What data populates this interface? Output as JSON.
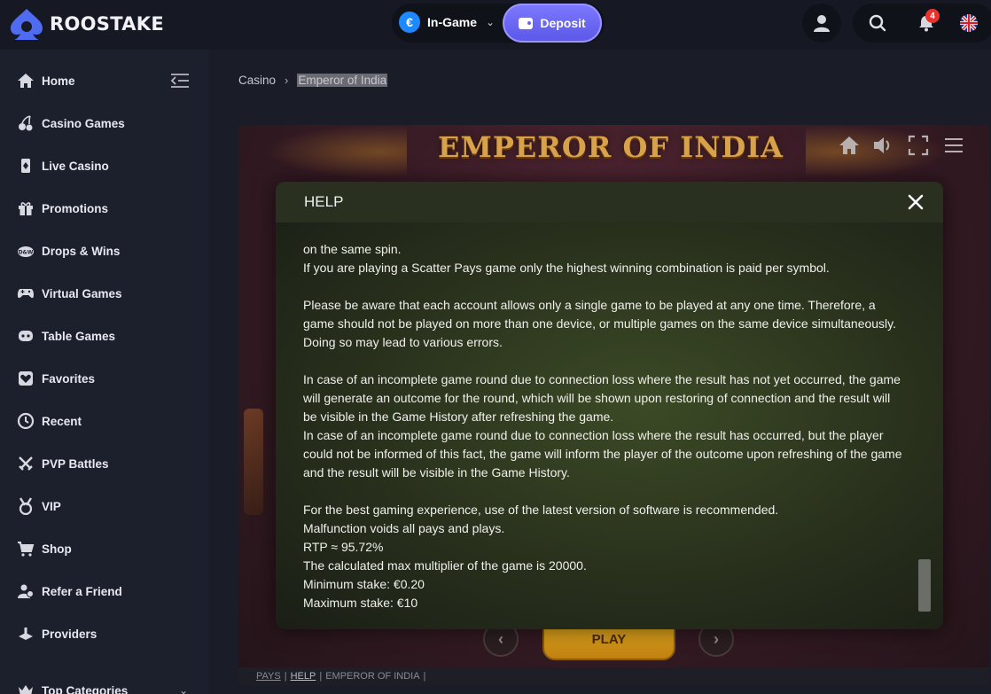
{
  "header": {
    "brand": "ROOSTAKE",
    "wallet": {
      "label": "In-Game",
      "currency_symbol": "€"
    },
    "deposit_label": "Deposit",
    "notification_count": "4"
  },
  "sidebar": {
    "items": [
      {
        "label": "Home",
        "icon": "home-icon"
      },
      {
        "label": "Casino Games",
        "icon": "cherries-icon"
      },
      {
        "label": "Live Casino",
        "icon": "card-icon"
      },
      {
        "label": "Promotions",
        "icon": "gift-icon"
      },
      {
        "label": "Drops & Wins",
        "icon": "drops-wins-icon"
      },
      {
        "label": "Virtual Games",
        "icon": "gamepad-icon"
      },
      {
        "label": "Table Games",
        "icon": "table-icon"
      },
      {
        "label": "Favorites",
        "icon": "heart-icon"
      },
      {
        "label": "Recent",
        "icon": "clock-icon"
      },
      {
        "label": "PVP Battles",
        "icon": "swords-icon"
      },
      {
        "label": "VIP",
        "icon": "medal-icon"
      },
      {
        "label": "Shop",
        "icon": "cart-icon"
      },
      {
        "label": "Refer a Friend",
        "icon": "users-icon"
      },
      {
        "label": "Providers",
        "icon": "providers-icon"
      },
      {
        "label": "Top Categories",
        "icon": "crown-icon"
      }
    ]
  },
  "breadcrumb": {
    "root": "Casino",
    "current": "Emperor of India"
  },
  "game": {
    "title": "EMPEROR OF INDIA",
    "play_label": "PLAY",
    "prev_symbol": "‹",
    "next_symbol": "›",
    "footer": {
      "pays": "PAYS",
      "help": "HELP",
      "name": "EMPEROR OF INDIA"
    }
  },
  "help_modal": {
    "title": "HELP",
    "lines": [
      "on the same spin.",
      "If you are playing a Scatter Pays game only the highest winning combination is paid per symbol.",
      "",
      "Please be aware that each account allows only a single game to be played at any one time. Therefore, a",
      "game should not be played on more than one device, or multiple games on the same device simultaneously.",
      "Doing so may lead to various errors.",
      "",
      "In case of an incomplete game round due to connection loss where the result has not yet occurred, the game",
      "will generate an outcome for the round, which will be shown upon restoring of connection and the result will",
      "be visible in the Game History after refreshing the game.",
      "In case of an incomplete game round due to connection loss where the result has occurred, but the player",
      "could not be informed of this fact, the game will inform the player of the outcome upon refreshing of the game",
      "and the result will be visible in the Game History.",
      "",
      "For the best gaming experience, use of the latest version of software is recommended.",
      "Malfunction voids all pays and plays.",
      "RTP ≈ 95.72%",
      "The calculated max multiplier of the game is 20000.",
      "Minimum stake: €0.20",
      "Maximum stake: €10"
    ]
  },
  "colors": {
    "accent": "#6b67f2",
    "sidebar_bg": "#1c1f2c",
    "page_bg": "#161824",
    "badge_red": "#e8322e"
  }
}
